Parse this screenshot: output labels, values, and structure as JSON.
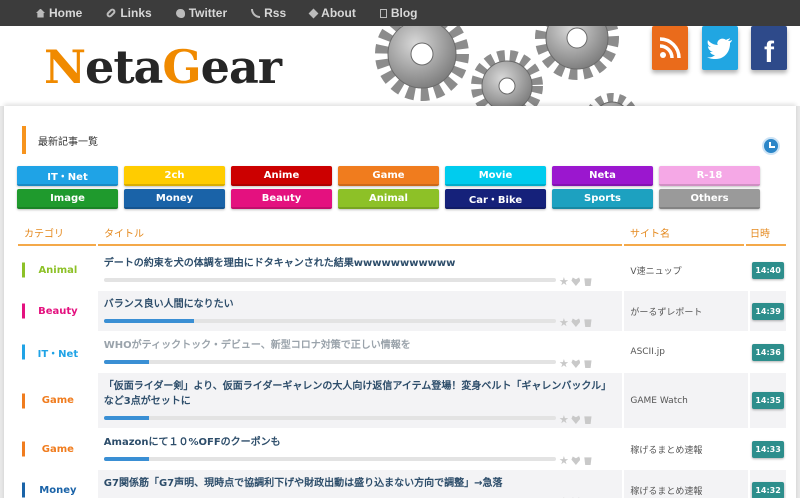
{
  "nav": [
    {
      "label": "Home",
      "icon": "home-icon"
    },
    {
      "label": "Links",
      "icon": "link-icon"
    },
    {
      "label": "Twitter",
      "icon": "twitter-icon"
    },
    {
      "label": "Rss",
      "icon": "rss-icon"
    },
    {
      "label": "About",
      "icon": "tag-icon"
    },
    {
      "label": "Blog",
      "icon": "document-icon"
    }
  ],
  "logo": {
    "p1": "N",
    "p2": "eta",
    "p3": "G",
    "p4": "ear"
  },
  "social": {
    "rss": "rss-icon",
    "twitter": "twitter-icon",
    "facebook": "facebook-icon",
    "fb_glyph": "f",
    "tw_glyph": "🐦"
  },
  "section_title": "最新記事一覧",
  "categories": [
    {
      "label": "IT・Net",
      "color": "#1fa3e6"
    },
    {
      "label": "2ch",
      "color": "#ffcc00"
    },
    {
      "label": "Anime",
      "color": "#cc0000"
    },
    {
      "label": "Game",
      "color": "#f07c1e"
    },
    {
      "label": "Movie",
      "color": "#00ccee"
    },
    {
      "label": "Neta",
      "color": "#9b17cf"
    },
    {
      "label": "R-18",
      "color": "#f5a8e6"
    },
    {
      "label": "Image",
      "color": "#1f9a2d"
    },
    {
      "label": "Money",
      "color": "#1a63a8"
    },
    {
      "label": "Beauty",
      "color": "#e4117f"
    },
    {
      "label": "Animal",
      "color": "#8dc127"
    },
    {
      "label": "Car・Bike",
      "color": "#15217a"
    },
    {
      "label": "Sports",
      "color": "#1da1c0"
    },
    {
      "label": "Others",
      "color": "#9a9a9a"
    }
  ],
  "table": {
    "headers": {
      "category": "カテゴリ",
      "title": "タイトル",
      "site": "サイト名",
      "time": "日時"
    },
    "rows": [
      {
        "category": "Animal",
        "cat_color": "#8dc127",
        "title": "デートの約束を犬の体調を理由にドタキャンされた結果wwwwwwwwwww",
        "site": "V速ニュップ",
        "time": "14:40",
        "progress": 0.0,
        "dim": false
      },
      {
        "category": "Beauty",
        "cat_color": "#e4117f",
        "title": "バランス良い人間になりたい",
        "site": "がーるずレポート",
        "time": "14:39",
        "progress": 0.2,
        "dim": false
      },
      {
        "category": "IT・Net",
        "cat_color": "#1fa3e6",
        "title": "WHOがティックトック・デビュー、新型コロナ対策で正しい情報を",
        "site": "ASCII.jp",
        "time": "14:36",
        "progress": 0.1,
        "dim": true
      },
      {
        "category": "Game",
        "cat_color": "#f07c1e",
        "title": "「仮面ライダー剣」より、仮面ライダーギャレンの大人向け返信アイテム登場！変身ベルト「ギャレンバックル」など3点がセットに",
        "site": "GAME Watch",
        "time": "14:35",
        "progress": 0.1,
        "dim": false
      },
      {
        "category": "Game",
        "cat_color": "#f07c1e",
        "title": "Amazonにて１０%OFFのクーポンも",
        "site": "稼げるまとめ速報",
        "time": "14:33",
        "progress": 0.1,
        "dim": false
      },
      {
        "category": "Money",
        "cat_color": "#1a63a8",
        "title": "G7関係筋「G7声明、現時点で協調利下げや財政出動は盛り込まない方向で調整」→急落",
        "site": "稼げるまとめ速報",
        "time": "14:32",
        "progress": 0.1,
        "dim": false
      }
    ]
  }
}
